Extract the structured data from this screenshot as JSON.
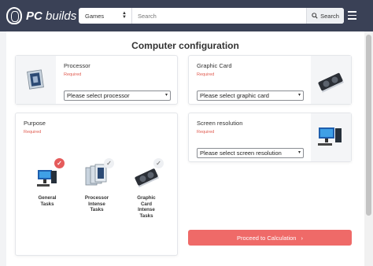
{
  "header": {
    "logo_pc": "PC",
    "logo_builds": "builds",
    "category": "Games",
    "search_placeholder": "Search",
    "search_button": "Search"
  },
  "main": {
    "title": "Computer configuration",
    "processor": {
      "label": "Processor",
      "required": "Required",
      "select": "Please select processor"
    },
    "graphic_card": {
      "label": "Graphic Card",
      "required": "Required",
      "select": "Please select graphic card"
    },
    "purpose": {
      "label": "Purpose",
      "required": "Required",
      "items": [
        {
          "label": "General\nTasks",
          "checked": true
        },
        {
          "label": "Processor\nIntense\nTasks",
          "checked": false
        },
        {
          "label": "Graphic\nCard\nIntense\nTasks",
          "checked": false
        }
      ]
    },
    "resolution": {
      "label": "Screen resolution",
      "required": "Required",
      "select": "Please select screen resolution"
    },
    "proceed": "Proceed to Calculation"
  },
  "colors": {
    "header": "#3a4156",
    "accent": "#ef6a68",
    "required": "#e05a4f"
  }
}
